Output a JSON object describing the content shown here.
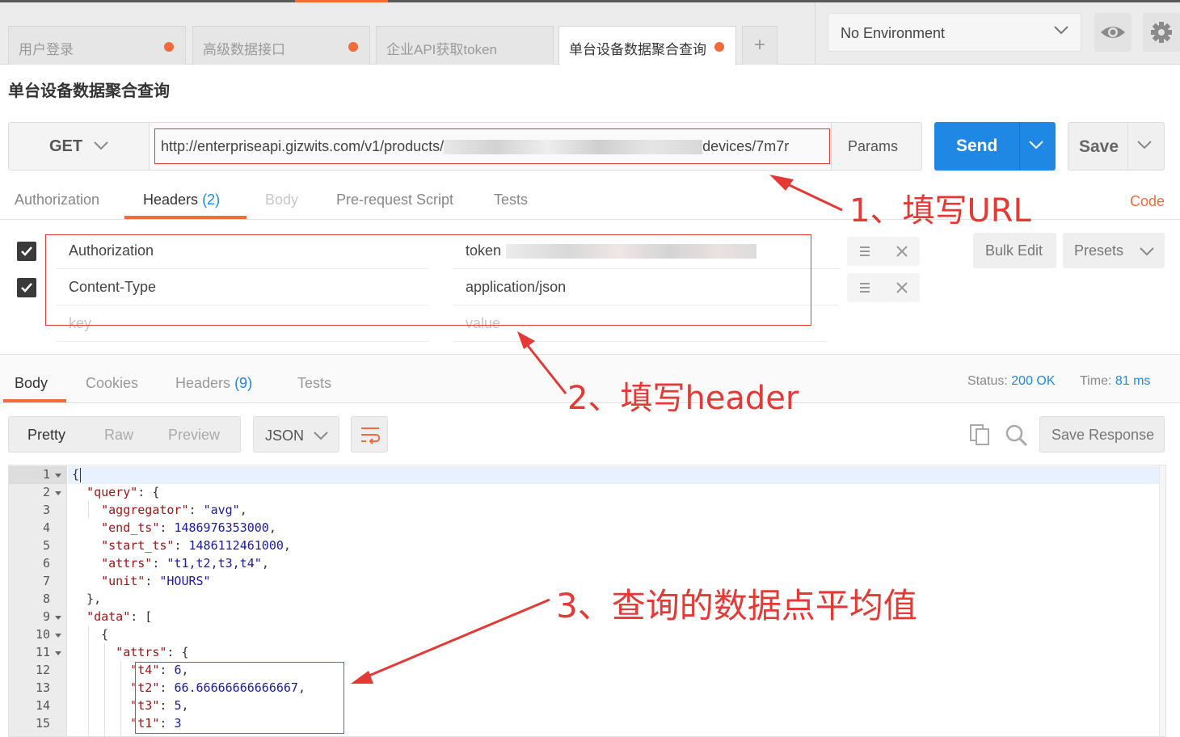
{
  "tabs": [
    {
      "label": "用户登录",
      "dirty": true
    },
    {
      "label": "高级数据接口",
      "dirty": true
    },
    {
      "label": "企业API获取token",
      "dirty": false
    },
    {
      "label": "单台设备数据聚合查询",
      "dirty": true
    }
  ],
  "add_tab": "+",
  "environment": {
    "selected": "No Environment"
  },
  "request": {
    "title": "单台设备数据聚合查询",
    "method": "GET",
    "url_prefix": "http://enterpriseapi.gizwits.com/v1/products/",
    "url_suffix": "devices/7m7r",
    "params_label": "Params",
    "send_label": "Send",
    "save_label": "Save"
  },
  "request_tabs": [
    {
      "label": "Authorization"
    },
    {
      "label": "Headers",
      "count": "(2)"
    },
    {
      "label": "Body"
    },
    {
      "label": "Pre-request Script"
    },
    {
      "label": "Tests"
    }
  ],
  "code_link": "Code",
  "headers": [
    {
      "key": "Authorization",
      "value": "token",
      "checked": true
    },
    {
      "key": "Content-Type",
      "value": "application/json",
      "checked": true
    }
  ],
  "headers_placeholder": {
    "key": "key",
    "value": "value"
  },
  "bulk_edit_label": "Bulk Edit",
  "presets_label": "Presets",
  "response_tabs": [
    {
      "label": "Body"
    },
    {
      "label": "Cookies"
    },
    {
      "label": "Headers",
      "count": "(9)"
    },
    {
      "label": "Tests"
    }
  ],
  "status": {
    "label": "Status:",
    "value": "200 OK"
  },
  "time": {
    "label": "Time:",
    "value": "81 ms"
  },
  "view_modes": [
    "Pretty",
    "Raw",
    "Preview"
  ],
  "format": "JSON",
  "save_response_label": "Save Response",
  "code_lines": [
    "{",
    "  \"query\": {",
    "    \"aggregator\": \"avg\",",
    "    \"end_ts\": 1486976353000,",
    "    \"start_ts\": 1486112461000,",
    "    \"attrs\": \"t1,t2,t3,t4\",",
    "    \"unit\": \"HOURS\"",
    "  },",
    "  \"data\": [",
    "    {",
    "      \"attrs\": {",
    "        \"t4\": 6,",
    "        \"t2\": 66.66666666666667,",
    "        \"t3\": 5,",
    "        \"t1\": 3"
  ],
  "annotations": [
    "1、填写URL",
    "2、填写header",
    "3、查询的数据点平均值"
  ],
  "colors": {
    "accent": "#f26b3a",
    "send": "#1f88e5",
    "annotation": "#e53935"
  }
}
